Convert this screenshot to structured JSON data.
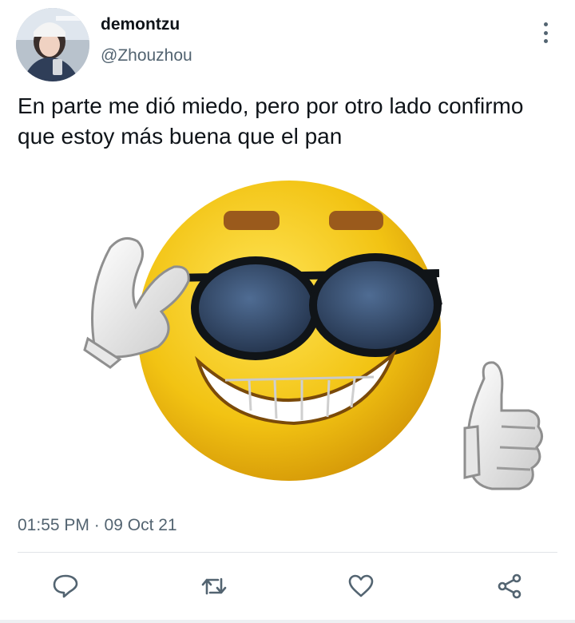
{
  "tweet": {
    "author_name": "demontzu",
    "author_handle": "@Zhouzhou",
    "text": "En parte me dió miedo, pero por otro lado confirmo que estoy más buena que el pan",
    "timestamp": "01:55 PM · 09 Oct 21"
  },
  "icons": {
    "menu": "more-vertical-icon",
    "reply": "reply-icon",
    "retweet": "retweet-icon",
    "like": "heart-icon",
    "share": "share-icon"
  },
  "colors": {
    "text": "#0f1419",
    "secondary": "#536471",
    "emoji_yellow": "#f2c313",
    "divider": "#e1e4e8"
  }
}
